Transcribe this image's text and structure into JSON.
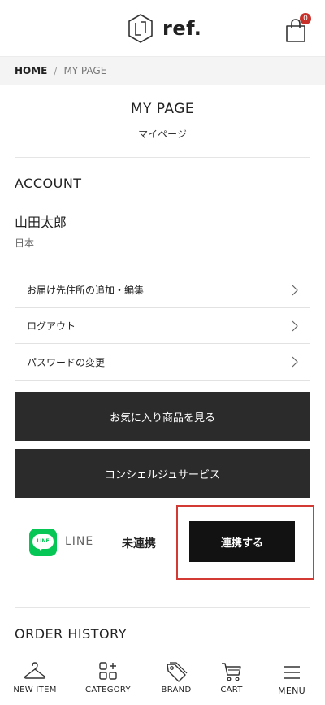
{
  "header": {
    "logo_text": "ref.",
    "cart_count": "0"
  },
  "breadcrumb": {
    "home": "HOME",
    "separator": "/",
    "current": "MY PAGE"
  },
  "page": {
    "title": "MY PAGE",
    "subtitle": "マイページ"
  },
  "account": {
    "heading": "ACCOUNT",
    "user_name": "山田太郎",
    "country": "日本",
    "menu": [
      {
        "label": "お届け先住所の追加・編集"
      },
      {
        "label": "ログアウト"
      },
      {
        "label": "パスワードの変更"
      }
    ],
    "favorites_button": "お気に入り商品を見る",
    "concierge_button": "コンシェルジュサービス"
  },
  "line": {
    "logo_text": "LINE",
    "label": "LINE",
    "status": "未連携",
    "link_button": "連携する"
  },
  "order_history": {
    "heading": "ORDER HISTORY"
  },
  "bottom_nav": [
    {
      "label": "NEW ITEM",
      "icon": "hanger-icon"
    },
    {
      "label": "CATEGORY",
      "icon": "category-grid-icon"
    },
    {
      "label": "BRAND",
      "icon": "tag-icon"
    },
    {
      "label": "CART",
      "icon": "cart-icon"
    },
    {
      "label": "MENU",
      "icon": "hamburger-menu-icon"
    }
  ],
  "colors": {
    "badge": "#c8322b",
    "dark_button": "#2b2b2b",
    "line_green": "#06c755",
    "highlight": "#d43a34"
  }
}
